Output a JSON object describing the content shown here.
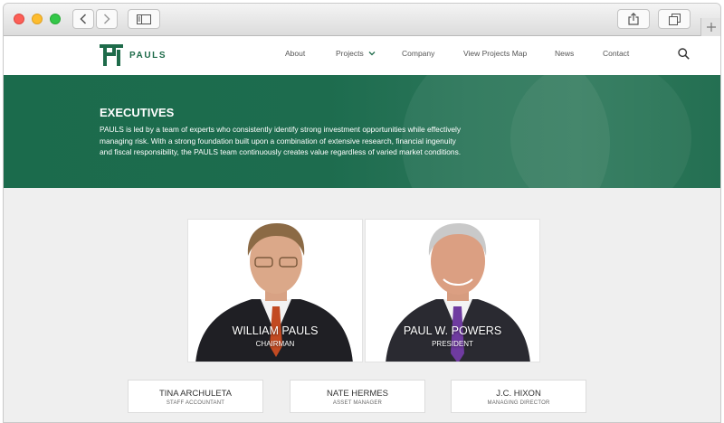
{
  "colors": {
    "brand_green": "#1e6b4a",
    "hero_green": "#1d6c4e",
    "content_bg": "#efefef"
  },
  "browser": {
    "icons": [
      "back-icon",
      "forward-icon",
      "sidebar-icon",
      "share-icon",
      "tabs-icon",
      "new-tab-icon"
    ]
  },
  "header": {
    "logo_text": "PAULS",
    "nav": [
      "About",
      "Projects",
      "Company",
      "View Projects Map",
      "News",
      "Contact"
    ]
  },
  "hero": {
    "title": "EXECUTIVES",
    "body": "PAULS is led by a team of experts who consistently identify strong investment opportunities while effectively managing risk. With a strong foundation built upon a combination of extensive research, financial ingenuity and fiscal responsibility, the PAULS team continuously creates value regardless of varied market conditions."
  },
  "executives": [
    {
      "name": "WILLIAM PAULS",
      "title": "CHAIRMAN"
    },
    {
      "name": "PAUL W. POWERS",
      "title": "PRESIDENT"
    }
  ],
  "staff": [
    {
      "name": "TINA ARCHULETA",
      "role": "STAFF ACCOUNTANT"
    },
    {
      "name": "NATE HERMES",
      "role": "ASSET MANAGER"
    },
    {
      "name": "J.C. HIXON",
      "role": "MANAGING DIRECTOR"
    }
  ]
}
